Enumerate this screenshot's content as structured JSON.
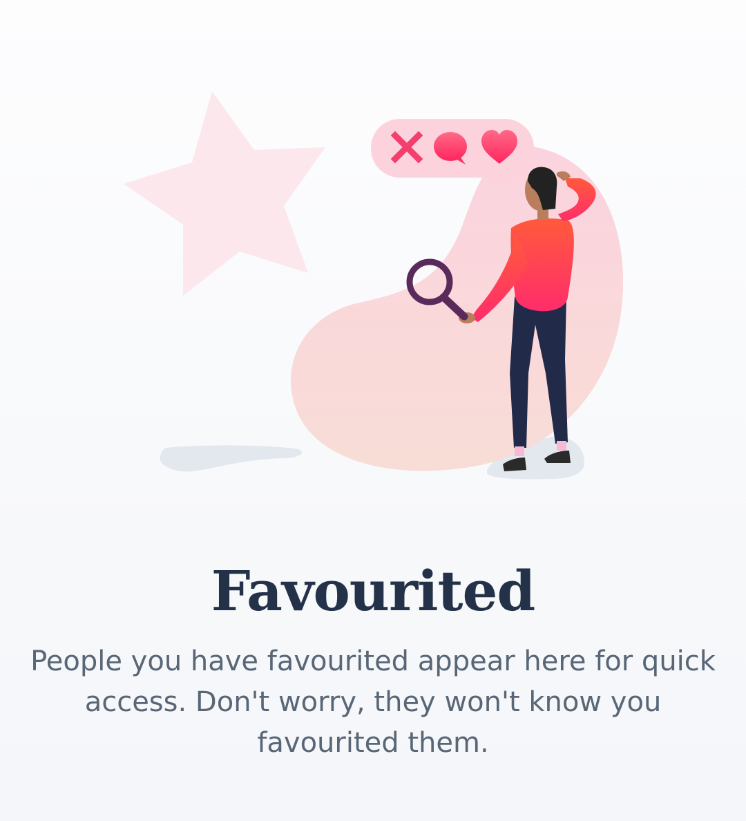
{
  "empty_state": {
    "title": "Favourited",
    "description": "People you have favourited appear here for quick access. Don't worry, they won't know you favourited them.",
    "illustration": {
      "icons": [
        "star-icon",
        "close-icon",
        "chat-bubble-icon",
        "heart-icon",
        "magnifier-icon"
      ],
      "colors": {
        "accent": "#ff2d6b",
        "accent_orange": "#ff5a3c",
        "blob": "#fadbd8",
        "star": "#fce3ea",
        "pants": "#222a4a",
        "magnifier": "#5a2a5a",
        "text_title": "#233248",
        "text_body": "#586676"
      }
    }
  }
}
